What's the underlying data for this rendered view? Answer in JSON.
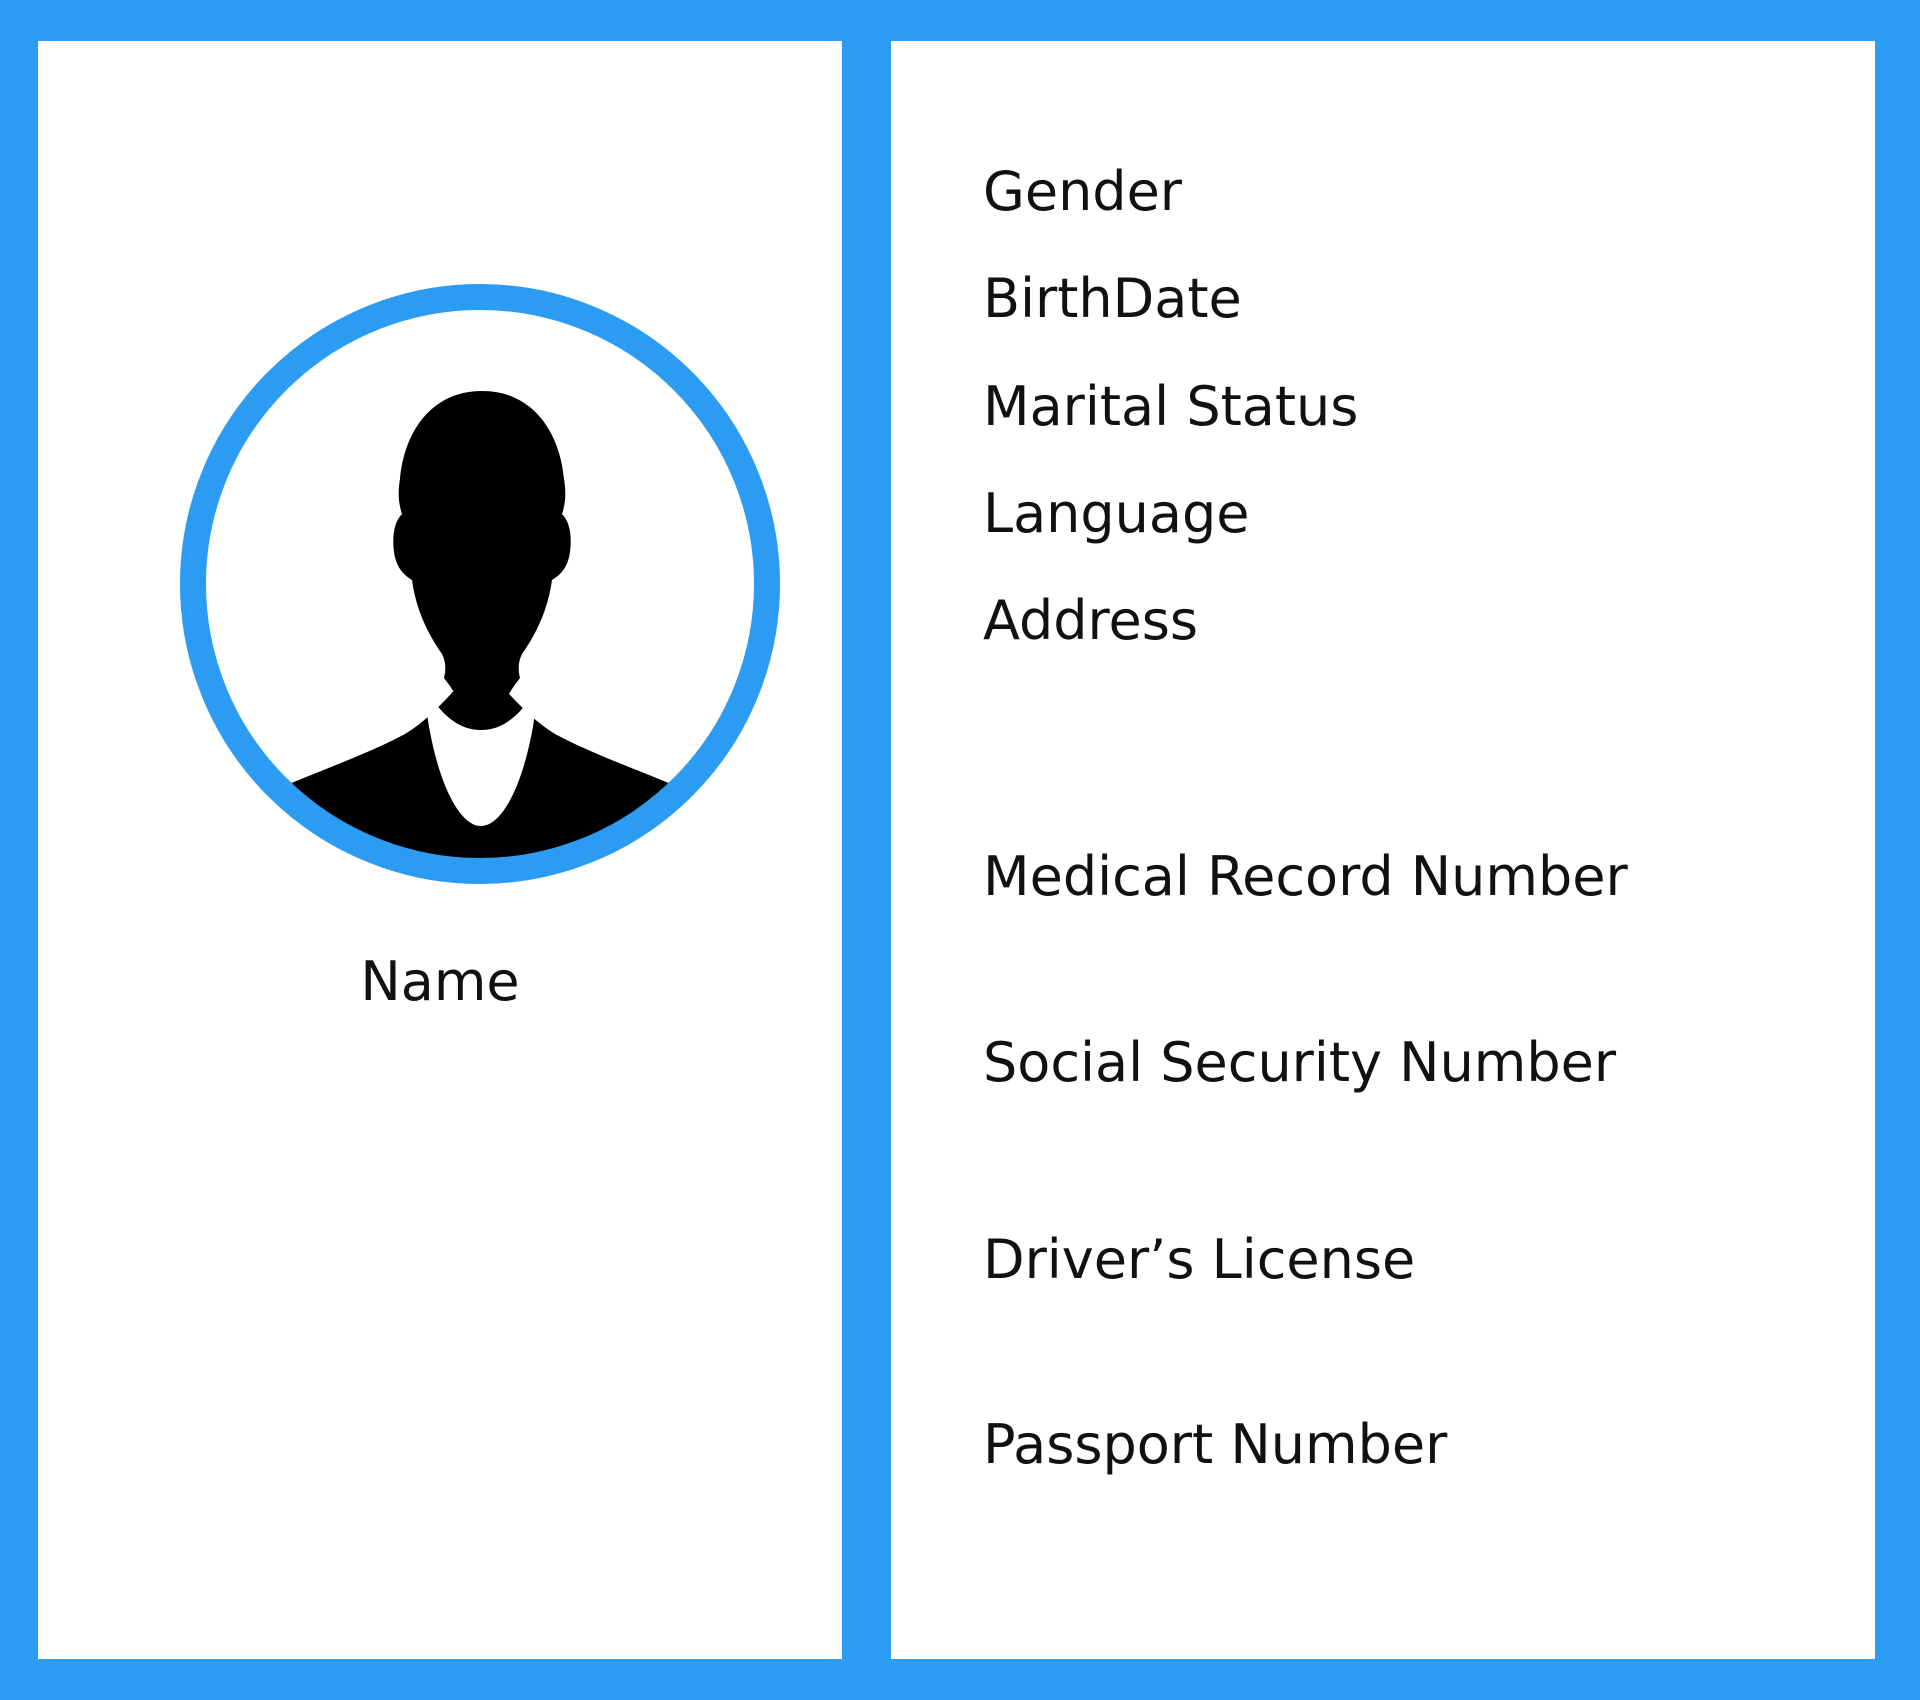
{
  "profile_card": {
    "accent_color": "#2c9cf3",
    "avatar": {
      "icon": "person-silhouette-icon"
    },
    "name_label": "Name",
    "fields": [
      {
        "label": "Gender"
      },
      {
        "label": "BirthDate"
      },
      {
        "label": "Marital Status"
      },
      {
        "label": "Language"
      },
      {
        "label": "Address"
      },
      {
        "label": "Medical Record Number"
      },
      {
        "label": "Social Security Number"
      },
      {
        "label": "Driver’s License"
      },
      {
        "label": "Passport Number"
      }
    ]
  }
}
